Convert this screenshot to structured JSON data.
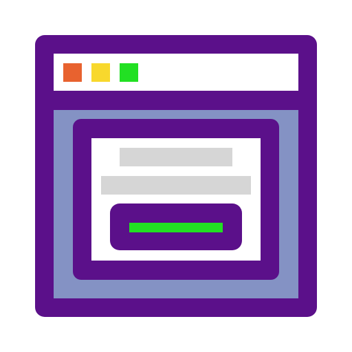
{
  "icon": {
    "name": "browser-dialog-icon",
    "colors": {
      "frame": "#5b108a",
      "content_background": "#8492c4",
      "titlebar": "#ffffff",
      "dialog_body": "#ffffff",
      "text_placeholder": "#d6d6d6",
      "button_bar": "#22e023"
    },
    "window_controls": [
      {
        "name": "close-dot",
        "color": "#e8622f"
      },
      {
        "name": "minimize-dot",
        "color": "#f8d82d"
      },
      {
        "name": "maximize-dot",
        "color": "#22e023"
      }
    ]
  }
}
